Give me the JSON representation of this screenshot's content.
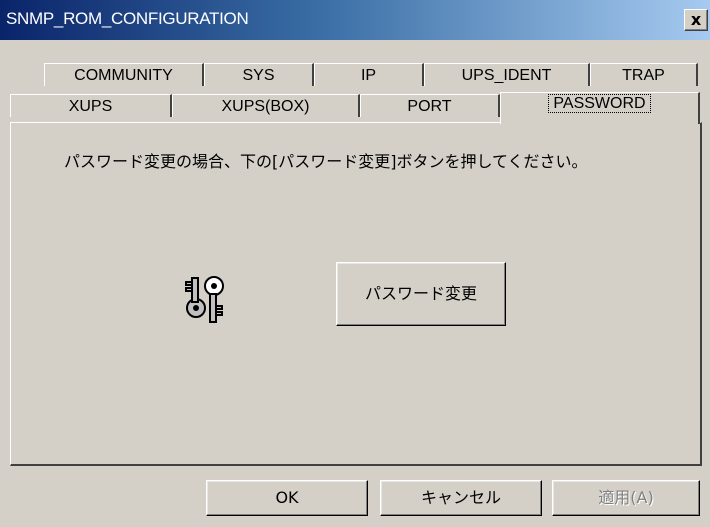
{
  "window": {
    "title": "SNMP_ROM_CONFIGURATION",
    "close_label": "x"
  },
  "tabs": {
    "row1": [
      {
        "label": "COMMUNITY"
      },
      {
        "label": "SYS"
      },
      {
        "label": "IP"
      },
      {
        "label": "UPS_IDENT"
      },
      {
        "label": "TRAP"
      }
    ],
    "row2": [
      {
        "label": "XUPS"
      },
      {
        "label": "XUPS(BOX)"
      },
      {
        "label": "PORT"
      },
      {
        "label": "PASSWORD",
        "active": true
      }
    ]
  },
  "panel": {
    "message": "パスワード変更の場合、下の[パスワード変更]ボタンを押してください。",
    "password_button_label": "パスワード変更",
    "icon": "keys-icon"
  },
  "footer": {
    "ok_label": "OK",
    "cancel_label": "キャンセル",
    "apply_label": "適用(A)"
  }
}
